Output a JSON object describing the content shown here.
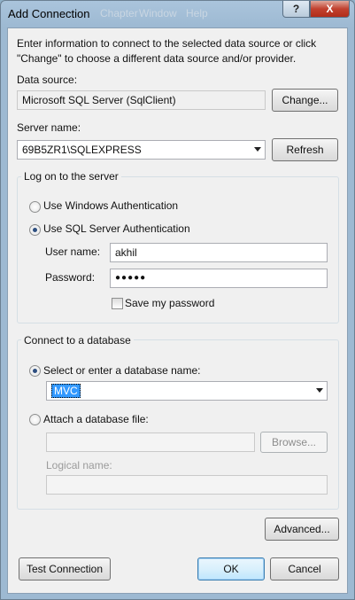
{
  "window": {
    "title": "Add Connection",
    "background_menu_ghost": [
      "Chapter",
      "Window",
      "Help"
    ],
    "help_glyph": "?",
    "close_glyph": "X"
  },
  "intro_text_line1": "Enter information to connect to the selected data source or click",
  "intro_text_line2": "\"Change\" to choose a different data source and/or provider.",
  "data_source": {
    "label": "Data source:",
    "value": "Microsoft SQL Server (SqlClient)",
    "change_button": "Change..."
  },
  "server": {
    "label": "Server name:",
    "value": "69B5ZR1\\SQLEXPRESS",
    "refresh_button": "Refresh"
  },
  "logon": {
    "group_title": "Log on to the server",
    "windows_auth_label": "Use Windows Authentication",
    "sql_auth_label": "Use SQL Server Authentication",
    "selected": "sql",
    "user_name_label": "User name:",
    "user_name_value": "akhil",
    "password_label": "Password:",
    "password_value": "●●●●●",
    "save_password_label": "Save my password",
    "save_password_checked": false
  },
  "database": {
    "group_title": "Connect to a database",
    "select_label": "Select or enter a database name:",
    "selected_db": "MVC",
    "attach_label": "Attach a database file:",
    "attach_value": "",
    "browse_button": "Browse...",
    "logical_name_label": "Logical name:",
    "logical_name_value": ""
  },
  "buttons": {
    "advanced": "Advanced...",
    "test_connection": "Test Connection",
    "ok": "OK",
    "cancel": "Cancel"
  },
  "colors": {
    "title_bar": "#9db9d2",
    "client_bg": "#f0f0f0",
    "close_button": "#c1412f",
    "selection": "#3399ff"
  }
}
